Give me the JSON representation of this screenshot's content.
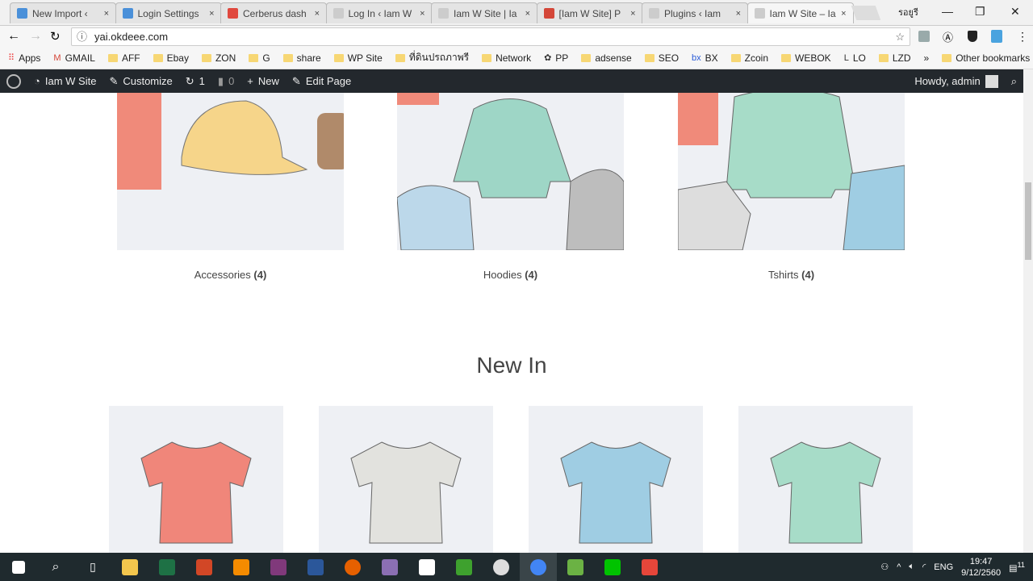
{
  "browser": {
    "tabs": [
      {
        "title": "New Import ‹",
        "icon_color": "#4a90d9",
        "active": false
      },
      {
        "title": "Login Settings",
        "icon_color": "#4a90d9",
        "active": false
      },
      {
        "title": "Cerberus dash",
        "icon_color": "#e0483e",
        "active": false
      },
      {
        "title": "Log In ‹ Iam W",
        "icon_color": "#ccc",
        "active": false
      },
      {
        "title": "Iam W Site | Ia",
        "icon_color": "#ccc",
        "active": false
      },
      {
        "title": "[Iam W Site] P",
        "icon_color": "#d44638",
        "active": false
      },
      {
        "title": "Plugins ‹ Iam",
        "icon_color": "#ccc",
        "active": false
      },
      {
        "title": "Iam W Site – Ia",
        "icon_color": "#ccc",
        "active": true
      }
    ],
    "close_glyph": "×",
    "profile_name": "รอยูรี",
    "window_controls": [
      "—",
      "❐",
      "✕"
    ],
    "url": "yai.okdeee.com",
    "bookmarks": [
      {
        "label": "Apps",
        "icon": "apps-grid-icon"
      },
      {
        "label": "GMAIL",
        "icon": "gmail-icon"
      },
      {
        "label": "AFF",
        "icon": "folder-icon"
      },
      {
        "label": "Ebay",
        "icon": "folder-icon"
      },
      {
        "label": "ZON",
        "icon": "folder-icon"
      },
      {
        "label": "G",
        "icon": "folder-icon"
      },
      {
        "label": "share",
        "icon": "folder-icon"
      },
      {
        "label": "WP Site",
        "icon": "folder-icon"
      },
      {
        "label": "ที่ดินปรถภาพรี",
        "icon": "folder-icon"
      },
      {
        "label": "Network",
        "icon": "folder-icon"
      },
      {
        "label": "PP",
        "icon": "pp-icon"
      },
      {
        "label": "adsense",
        "icon": "folder-icon"
      },
      {
        "label": "SEO",
        "icon": "folder-icon"
      },
      {
        "label": "BX",
        "icon": "bx-icon"
      },
      {
        "label": "Zcoin",
        "icon": "folder-icon"
      },
      {
        "label": "WEBOK",
        "icon": "folder-icon"
      },
      {
        "label": "LO",
        "icon": "lo-icon"
      },
      {
        "label": "LZD",
        "icon": "folder-icon"
      }
    ],
    "more_bookmarks": "»",
    "other_bookmarks": "Other bookmarks"
  },
  "adminbar": {
    "site": "Iam W Site",
    "customize": "Customize",
    "updates": "1",
    "comments": "0",
    "new": "New",
    "edit": "Edit Page",
    "howdy": "Howdy, admin"
  },
  "categories": [
    {
      "name": "Accessories",
      "count": "(4)"
    },
    {
      "name": "Hoodies",
      "count": "(4)"
    },
    {
      "name": "Tshirts",
      "count": "(4)"
    }
  ],
  "new_in": {
    "heading": "New In",
    "products": [
      {
        "color": "#f0867a"
      },
      {
        "color": "#e2e2de"
      },
      {
        "color": "#9fcde3"
      },
      {
        "color": "#a7dcc8"
      }
    ]
  },
  "taskbar": {
    "apps": [
      {
        "name": "file-explorer",
        "color": "#f3c64d"
      },
      {
        "name": "excel",
        "color": "#1e7145"
      },
      {
        "name": "powerpoint",
        "color": "#d24726"
      },
      {
        "name": "vlc",
        "color": "#f48b00"
      },
      {
        "name": "onenote",
        "color": "#80397b"
      },
      {
        "name": "word",
        "color": "#2b579a"
      },
      {
        "name": "firefox",
        "color": "#e66000"
      },
      {
        "name": "app-purple",
        "color": "#8b6fb3"
      },
      {
        "name": "dropbox",
        "color": "#fff"
      },
      {
        "name": "camtasia",
        "color": "#3ea12e"
      },
      {
        "name": "app-t",
        "color": "#ddd"
      },
      {
        "name": "chrome",
        "color": "#4285f4"
      },
      {
        "name": "app-green",
        "color": "#6bb244"
      },
      {
        "name": "line",
        "color": "#00c300"
      },
      {
        "name": "app-red",
        "color": "#e6463a"
      }
    ],
    "language": "ENG",
    "time": "19:47",
    "date": "9/12/2560",
    "notifications": "11"
  }
}
